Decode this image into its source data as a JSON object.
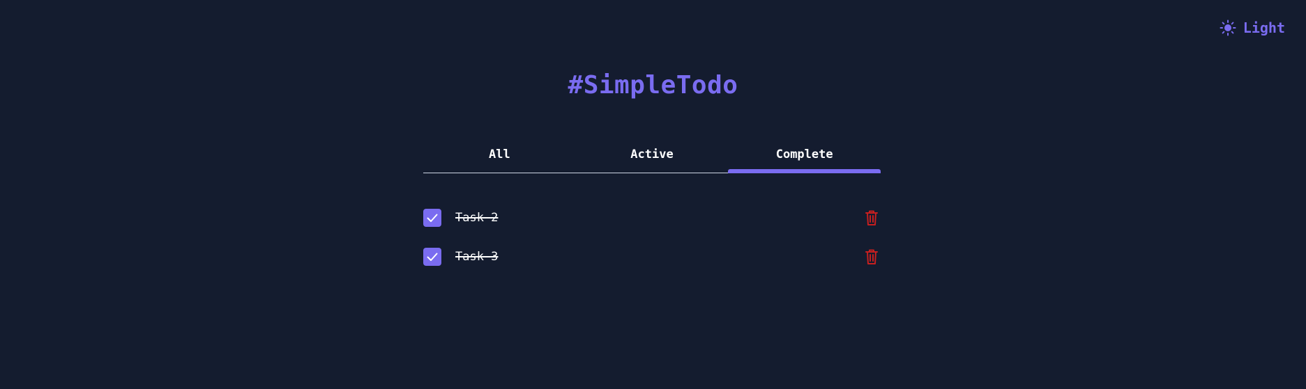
{
  "theme_toggle": {
    "icon": "sun-icon",
    "label": "Light",
    "color": "#7a6cf0"
  },
  "header": {
    "title": "#SimpleTodo"
  },
  "tabs": [
    {
      "label": "All",
      "active": false
    },
    {
      "label": "Active",
      "active": false
    },
    {
      "label": "Complete",
      "active": true
    }
  ],
  "tasks": [
    {
      "label": "Task 2",
      "completed": true
    },
    {
      "label": "Task 3",
      "completed": true
    }
  ],
  "colors": {
    "background": "#141c2f",
    "accent": "#7a6cf0",
    "danger": "#c81f1f",
    "divider": "#cfd7e6"
  }
}
